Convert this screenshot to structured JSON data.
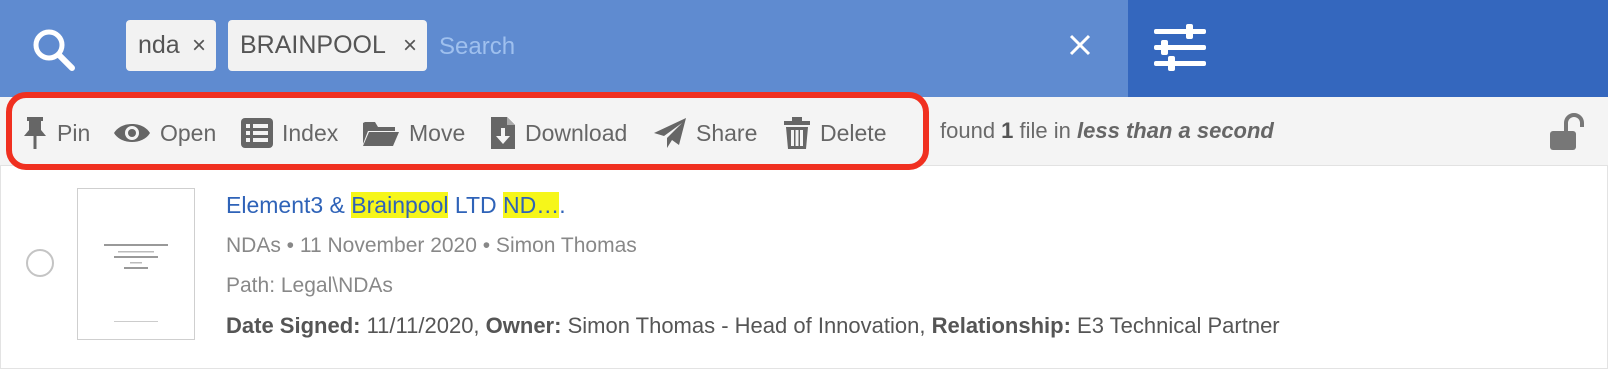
{
  "search": {
    "tags": [
      {
        "label": "nda"
      },
      {
        "label": "BRAINPOOL"
      }
    ],
    "tag_remove_glyph": "×",
    "placeholder": "Search",
    "icons": {
      "search": "magnifier-icon",
      "clear": "close-icon",
      "filters": "sliders-icon"
    }
  },
  "toolbar": {
    "actions": [
      {
        "label": "Pin",
        "icon": "pin-icon"
      },
      {
        "label": "Open",
        "icon": "eye-icon"
      },
      {
        "label": "Index",
        "icon": "list-icon"
      },
      {
        "label": "Move",
        "icon": "folder-open-icon"
      },
      {
        "label": "Download",
        "icon": "download-file-icon"
      },
      {
        "label": "Share",
        "icon": "paper-plane-icon"
      },
      {
        "label": "Delete",
        "icon": "trash-icon"
      }
    ],
    "status": {
      "prefix": "found ",
      "count": "1",
      "middle": " file in ",
      "duration": "less than a second"
    },
    "lock_icon": "unlocked-padlock-icon",
    "highlight_color": "#f03020"
  },
  "results": [
    {
      "title_parts": [
        "Element3 & ",
        "Brainpool",
        " LTD ",
        "ND…",
        "."
      ],
      "meta": "NDAs • 11 November 2020 • Simon Thomas",
      "path": "Path: Legal\\NDAs",
      "props": [
        {
          "key": "Date Signed:",
          "value": " 11/11/2020, "
        },
        {
          "key": "Owner:",
          "value": " Simon Thomas - Head of Innovation, "
        },
        {
          "key": "Relationship:",
          "value": " E3 Technical Partner"
        }
      ]
    }
  ],
  "colors": {
    "search_bar": "#5f8bd0",
    "settings_bar": "#3467be",
    "link": "#2f63b8",
    "highlight": "#f6f61a"
  }
}
